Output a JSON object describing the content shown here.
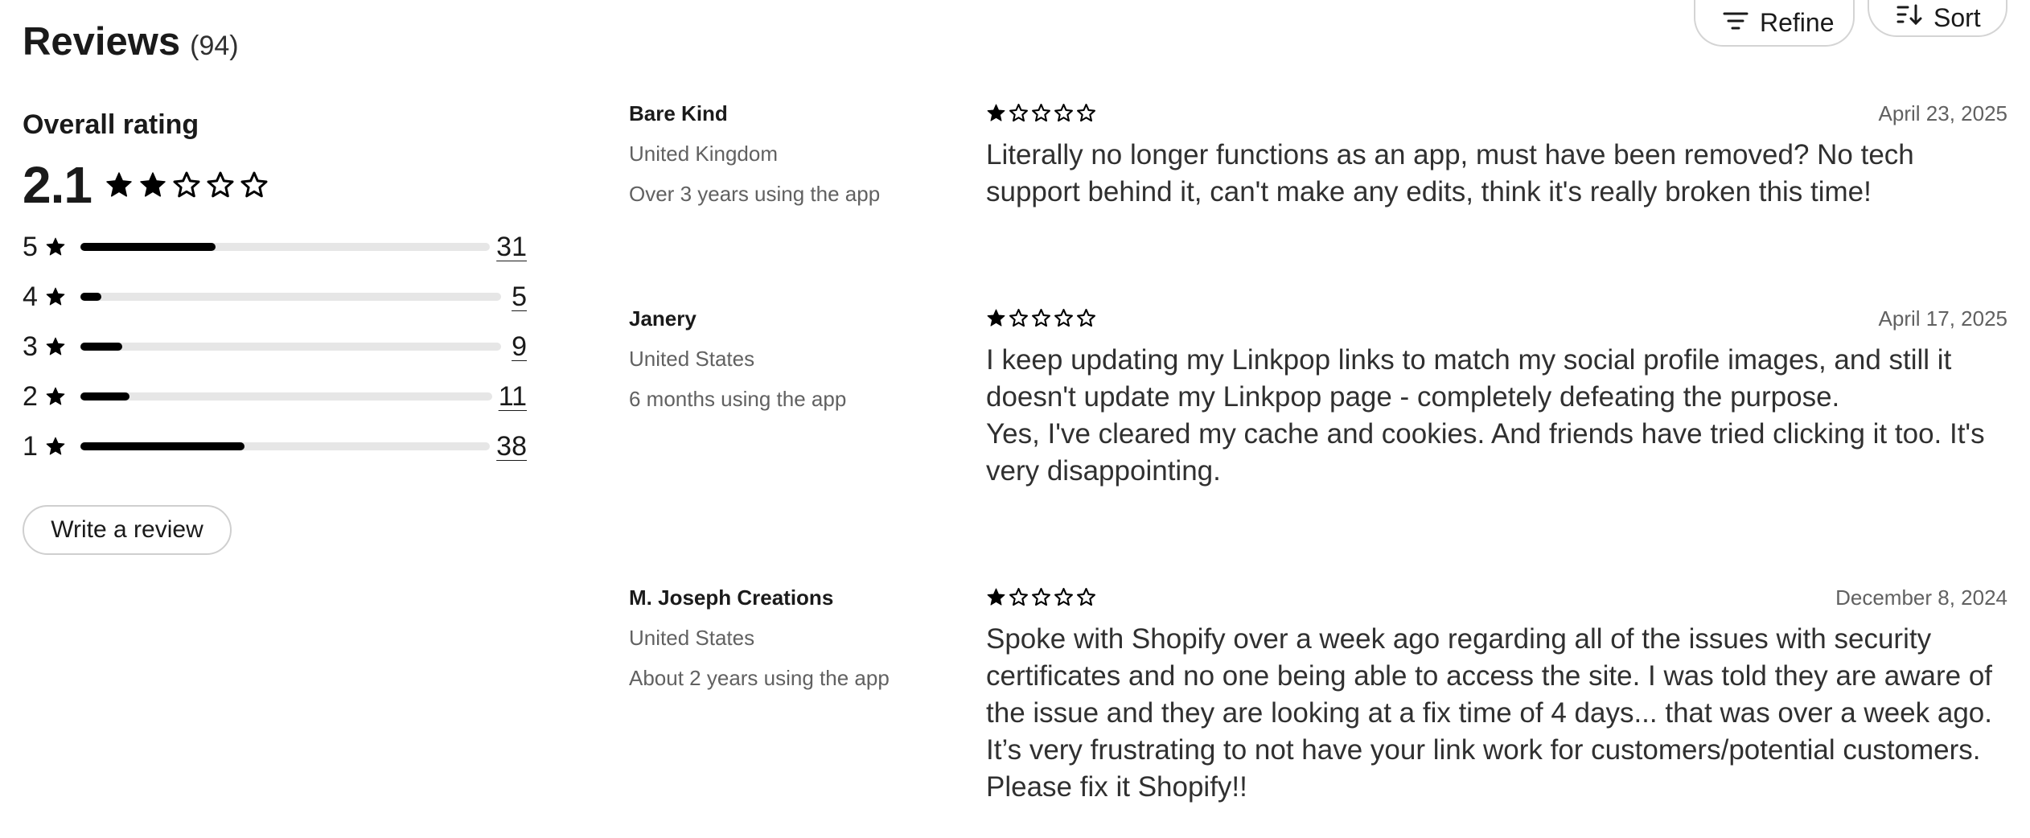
{
  "header": {
    "title": "Reviews",
    "count": "(94)",
    "refine_label": "Refine",
    "sort_label": "Sort"
  },
  "summary": {
    "overall_label": "Overall rating",
    "overall_value": "2.1",
    "overall_stars_filled": 2,
    "distribution": [
      {
        "stars": "5",
        "count": "31",
        "fraction": 0.33
      },
      {
        "stars": "4",
        "count": "5",
        "fraction": 0.05
      },
      {
        "stars": "3",
        "count": "9",
        "fraction": 0.1
      },
      {
        "stars": "2",
        "count": "11",
        "fraction": 0.12
      },
      {
        "stars": "1",
        "count": "38",
        "fraction": 0.4
      }
    ],
    "write_review_label": "Write a review"
  },
  "reviews": [
    {
      "name": "Bare Kind",
      "country": "United Kingdom",
      "tenure": "Over 3 years using the app",
      "rating": 1,
      "date": "April 23, 2025",
      "body": [
        "Literally no longer functions as an app, must have been removed? No tech support behind it, can't make any edits, think it's really broken this time!"
      ]
    },
    {
      "name": "Janery",
      "country": "United States",
      "tenure": "6 months using the app",
      "rating": 1,
      "date": "April 17, 2025",
      "body": [
        "I keep updating my Linkpop links to match my social profile images, and still it doesn't update my Linkpop page - completely defeating the purpose.",
        "Yes, I've cleared my cache and cookies. And friends have tried clicking it too. It's very disappointing."
      ]
    },
    {
      "name": "M. Joseph Creations",
      "country": "United States",
      "tenure": "About 2 years using the app",
      "rating": 1,
      "date": "December 8, 2024",
      "body": [
        "Spoke with Shopify over a week ago regarding all of the issues with security certificates and no one being able to access the site. I was told they are aware of the issue and they are looking at a fix time of 4 days... that was over a week ago.",
        "It’s very frustrating to not have your link work for customers/potential customers. Please fix it Shopify!!"
      ]
    }
  ],
  "icons": {
    "refine": "filter-lines-icon",
    "sort": "sort-arrows-icon",
    "star_filled": "star-filled-icon",
    "star_empty": "star-outline-icon"
  }
}
